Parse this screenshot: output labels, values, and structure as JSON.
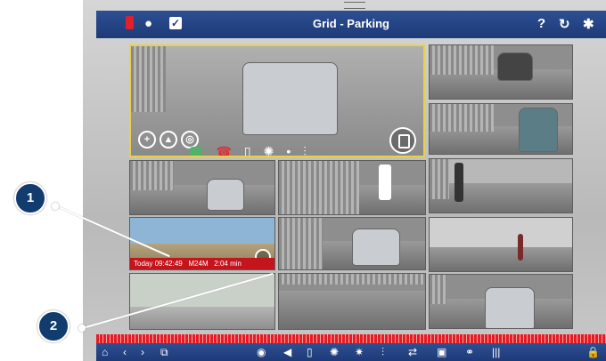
{
  "header": {
    "title": "Grid - Parking",
    "help_glyph": "?",
    "reload_glyph": "↻",
    "settings_glyph": "✱",
    "chat_glyph": "●",
    "check_glyph": "✓"
  },
  "main_view": {
    "zoom_in_glyph": "+",
    "mountain_glyph": "▲",
    "target_glyph": "◎",
    "call_accept_glyph": "☎",
    "call_reject_glyph": "☎",
    "door_glyph": "▯",
    "sun1_glyph": "✺",
    "sun2_glyph": "•",
    "thermo_glyph": "⫶"
  },
  "event_cell": {
    "timestamp": "Today 09:42:49",
    "camera_id": "M24M",
    "extra": "2:04 min"
  },
  "callouts": [
    "1",
    "2"
  ],
  "bottombar": {
    "home_glyph": "⌂",
    "prev_glyph": "‹",
    "next_glyph": "›",
    "layout_glyph": "⧉",
    "speaker_glyph": "◀",
    "door_glyph": "▯",
    "sun_glyph": "✺",
    "sunb_glyph": "✷",
    "thermo_glyph": "⫶",
    "loop_glyph": "⇄",
    "snapshot_glyph": "▣",
    "share_glyph": "⚭",
    "bars_glyph": "|||",
    "lock_glyph": "🔒",
    "camera_glyph": "◉"
  },
  "colors": {
    "bar_blue": "#1e3a78",
    "alarm_red": "#e0202a",
    "timeline_red": "#e41d25",
    "callout_navy": "#123b6e",
    "selection_yellow": "#e8d14a"
  }
}
